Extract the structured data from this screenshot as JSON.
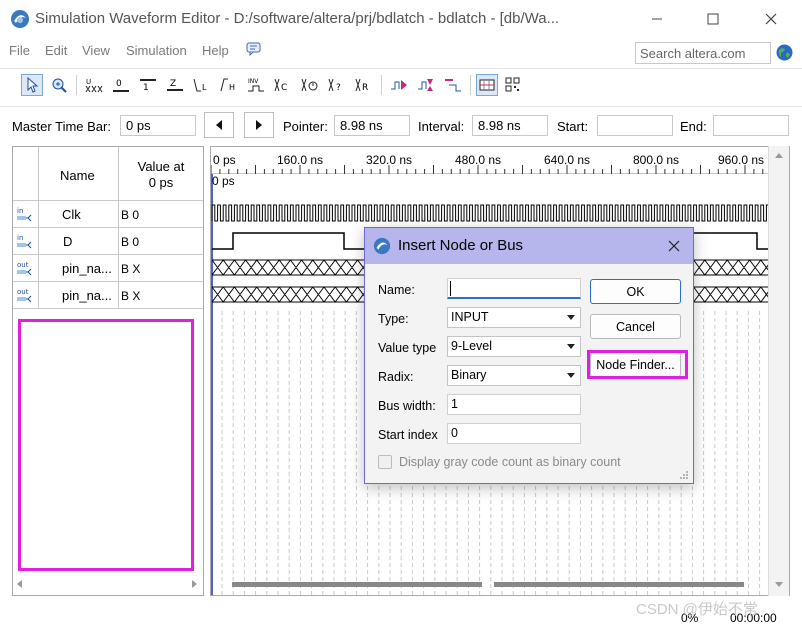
{
  "window": {
    "title": "Simulation Waveform Editor - D:/software/altera/prj/bdlatch - bdlatch - [db/Wa..."
  },
  "menu": {
    "items": [
      "File",
      "Edit",
      "View",
      "Simulation",
      "Help"
    ],
    "search_placeholder": "Search altera.com"
  },
  "toolbar": {
    "icons": [
      "pointer-tool-icon",
      "zoom-tool-icon",
      "uninitialized-icon",
      "forcing-low-icon",
      "forcing-high-icon",
      "high-impedance-icon",
      "weak-low-icon",
      "weak-high-icon",
      "invert-icon",
      "count-value-icon",
      "clock-icon",
      "dont-care-icon",
      "random-value-icon",
      "snap-to-grid-icon",
      "grid-settings-icon",
      "run-timing-sim-icon",
      "run-functional-sim-icon",
      "generate-netlist-icon",
      "sort-icon"
    ]
  },
  "timebar": {
    "master_label": "Master Time Bar:",
    "master_value": "0 ps",
    "pointer_label": "Pointer:",
    "pointer_value": "8.98 ns",
    "interval_label": "Interval:",
    "interval_value": "8.98 ns",
    "start_label": "Start:",
    "start_value": "",
    "end_label": "End:",
    "end_value": ""
  },
  "node_table": {
    "col_name": "Name",
    "col_value_line1": "Value at",
    "col_value_line2": "0 ps",
    "rows": [
      {
        "icon": "in",
        "name": "Clk",
        "value": "B 0"
      },
      {
        "icon": "in",
        "name": "D",
        "value": "B 0"
      },
      {
        "icon": "out",
        "name": "pin_na...",
        "value": "B X"
      },
      {
        "icon": "out",
        "name": "pin_na...",
        "value": "B X"
      }
    ]
  },
  "waveform": {
    "cursor_label": "0 ps",
    "ruler_ticks": [
      "0 ps",
      "160.0 ns",
      "320.0 ns",
      "480.0 ns",
      "640.0 ns",
      "800.0 ns",
      "960.0 ns"
    ]
  },
  "dialog": {
    "title": "Insert Node or Bus",
    "name_label": "Name:",
    "name_value": "",
    "type_label": "Type:",
    "type_value": "INPUT",
    "value_type_label": "Value type",
    "value_type_value": "9-Level",
    "radix_label": "Radix:",
    "radix_value": "Binary",
    "bus_width_label": "Bus width:",
    "bus_width_value": "1",
    "start_index_label": "Start index",
    "start_index_value": "0",
    "ok_label": "OK",
    "cancel_label": "Cancel",
    "node_finder_label": "Node Finder...",
    "checkbox_label": "Display gray code count as binary count",
    "checkbox_checked": false
  },
  "status": {
    "percent": "0%",
    "time": "00:00:00"
  },
  "watermark": "CSDN @伊始不常",
  "colors": {
    "highlight": "#e020e0",
    "dialog_title": "#b7b6ec",
    "wave_line": "#000000"
  }
}
